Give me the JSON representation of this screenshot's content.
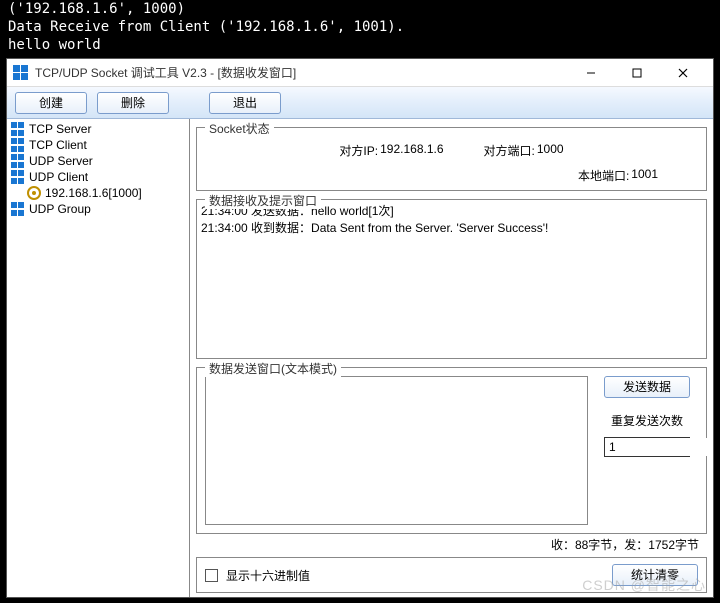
{
  "console": {
    "lines": [
      "('192.168.1.6', 1000)",
      "Data Receive from Client ('192.168.1.6', 1001).",
      " hello world"
    ]
  },
  "window": {
    "title": "TCP/UDP Socket 调试工具 V2.3 - [数据收发窗口]"
  },
  "toolbar": {
    "create": "创建",
    "delete": "删除",
    "exit": "退出"
  },
  "tree": {
    "items": [
      {
        "label": "TCP Server",
        "type": "node"
      },
      {
        "label": "TCP Client",
        "type": "node"
      },
      {
        "label": "UDP Server",
        "type": "node"
      },
      {
        "label": "UDP Client",
        "type": "node"
      },
      {
        "label": "192.168.1.6[1000]",
        "type": "child"
      },
      {
        "label": "UDP Group",
        "type": "node"
      }
    ]
  },
  "status": {
    "group_title": "Socket状态",
    "peer_ip_label": "对方IP:",
    "peer_ip": "192.168.1.6",
    "peer_port_label": "对方端口:",
    "peer_port": "1000",
    "local_port_label": "本地端口:",
    "local_port": "1001"
  },
  "recv": {
    "group_title": "数据接收及提示窗口",
    "lines": [
      "21:34:00 发送数据：hello world[1次]",
      "21:34:00 收到数据：Data Sent from the Server. 'Server Success'!"
    ]
  },
  "send": {
    "group_title": "数据发送窗口(文本模式)",
    "send_button": "发送数据",
    "repeat_label": "重复发送次数",
    "repeat_value": "1"
  },
  "stats": {
    "text": "收：88字节，发：1752字节"
  },
  "bottom": {
    "hex_label": "显示十六进制值",
    "clear_button": "统计清零"
  },
  "watermark": "CSDN @智能之心"
}
